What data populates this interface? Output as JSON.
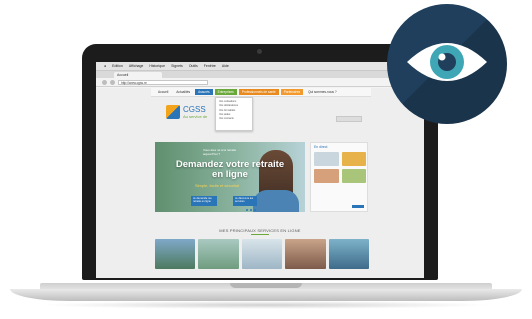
{
  "browser": {
    "menu": [
      "Edition",
      "Affichage",
      "Historique",
      "Signets",
      "Outils",
      "Fenêtre",
      "Aide"
    ],
    "tab_title": "Accueil",
    "url": "http://www.cgss.re"
  },
  "site": {
    "nav": [
      "Accueil",
      "Actualités",
      "Assurés",
      "Entreprises",
      "Professionnels de santé",
      "Partenaires",
      "Qui sommes-nous ?"
    ],
    "dropdown": [
      "Vos cotisations",
      "Vos déclarations",
      "Vos formalités",
      "Vos aides",
      "Vos contacts"
    ],
    "logo_name": "CGSS",
    "logo_tagline": "Au service de",
    "hero": {
      "kicker": "Vous êtes né à la retraite aujourd'hui ?",
      "title": "Demandez votre retraite en ligne",
      "cta": "Simple, facile et sécurisé",
      "button1": "Je demande ma retraite en ligne",
      "button2": "Je découvre les services"
    },
    "news_title": "En direct",
    "services_title": "MES PRINCIPAUX SERVICES EN LIGNE"
  },
  "badge": {
    "icon": "eye-icon",
    "color_bg": "#1f3f5c",
    "color_iris": "#3fa6b5"
  }
}
